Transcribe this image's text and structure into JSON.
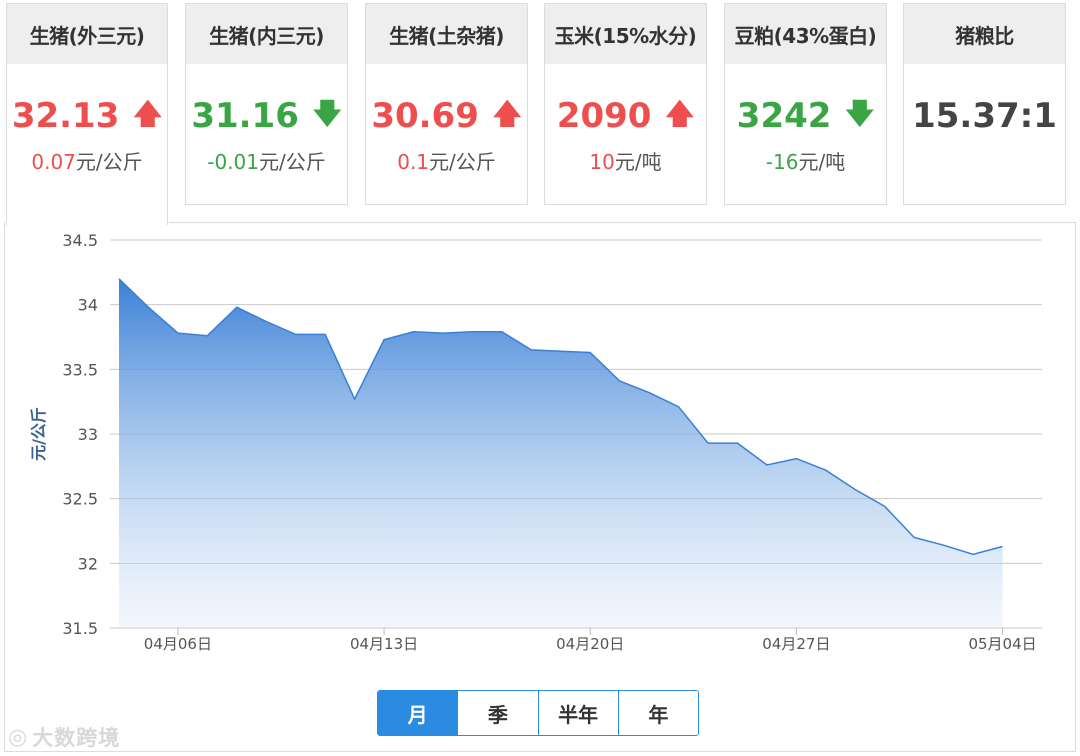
{
  "cards": [
    {
      "title": "生猪(外三元)",
      "value": "32.13",
      "arrow": "🡅",
      "direction": "up",
      "delta": "0.07",
      "unit": "元/公斤"
    },
    {
      "title": "生猪(内三元)",
      "value": "31.16",
      "arrow": "🡇",
      "direction": "down",
      "delta": "-0.01",
      "unit": "元/公斤"
    },
    {
      "title": "生猪(土杂猪)",
      "value": "30.69",
      "arrow": "🡅",
      "direction": "up",
      "delta": "0.1",
      "unit": "元/公斤"
    },
    {
      "title": "玉米(15%水分)",
      "value": "2090",
      "arrow": "🡅",
      "direction": "up",
      "delta": "10",
      "unit": "元/吨"
    },
    {
      "title": "豆粕(43%蛋白)",
      "value": "3242",
      "arrow": "🡇",
      "direction": "down",
      "delta": "-16",
      "unit": "元/吨"
    },
    {
      "title": "猪粮比",
      "value": "15.37:1",
      "arrow": "",
      "direction": "neutral",
      "delta": "",
      "unit": ""
    }
  ],
  "colors": {
    "up": "#ee4e4e",
    "down": "#3aa544",
    "accent": "#2b8be0",
    "line": "#3b7fd4"
  },
  "range_tabs": [
    {
      "label": "月",
      "selected": true
    },
    {
      "label": "季",
      "selected": false
    },
    {
      "label": "半年",
      "selected": false
    },
    {
      "label": "年",
      "selected": false
    }
  ],
  "watermark": {
    "icon": "◎",
    "text": "大数跨境"
  },
  "chart_data": {
    "type": "area",
    "ylabel": "元/公斤",
    "ylim": [
      31.5,
      34.5
    ],
    "yticks": [
      "34.5",
      "34",
      "33.5",
      "33",
      "32.5",
      "32",
      "31.5"
    ],
    "x_range": [
      0,
      31
    ],
    "xticks": [
      {
        "x": 2,
        "label": "04月06日"
      },
      {
        "x": 9,
        "label": "04月13日"
      },
      {
        "x": 16,
        "label": "04月20日"
      },
      {
        "x": 23,
        "label": "04月27日"
      },
      {
        "x": 30,
        "label": "05月04日"
      }
    ],
    "grid": true,
    "series": [
      {
        "x": [
          0,
          1,
          2,
          3,
          4,
          5,
          6,
          7,
          8,
          9,
          10,
          11,
          12,
          13,
          14,
          15,
          16,
          17,
          18,
          19,
          20,
          21,
          22,
          23,
          24,
          25,
          26,
          27,
          28,
          29,
          30
        ],
        "values": [
          34.2,
          33.98,
          33.78,
          33.76,
          33.98,
          33.87,
          33.77,
          33.77,
          33.27,
          33.73,
          33.79,
          33.78,
          33.79,
          33.79,
          33.65,
          33.64,
          33.63,
          33.41,
          33.32,
          33.21,
          32.93,
          32.93,
          32.76,
          32.81,
          32.72,
          32.57,
          32.44,
          32.2,
          32.14,
          32.07,
          32.13
        ]
      }
    ]
  }
}
